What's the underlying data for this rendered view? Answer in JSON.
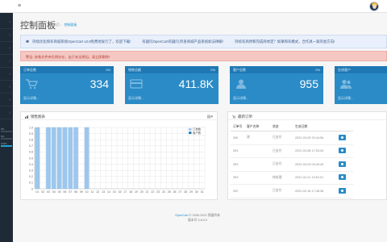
{
  "header": {
    "menu_icon": "hamburger-icon",
    "avatar_icon": "user-avatar-icon"
  },
  "sidebar": {
    "stats": [
      {
        "label": "0%",
        "percent": 0
      },
      {
        "label": "0%",
        "percent": 0
      },
      {
        "label": "100%",
        "percent": 100
      }
    ]
  },
  "page": {
    "title": "控制面板",
    "breadcrumb": [
      {
        "label": "首页"
      },
      {
        "label": "控制面板"
      }
    ]
  },
  "alerts": {
    "info_parts": [
      "持续优化和有商城系统OpenCart v3.8免费地发行了，欢迎下载!",
      "有疑问OpenCart有疑问,所查商城产品系统如法律解!",
      "持续有商用和完成商体定？如果和有模式，合作具一家的会方向!"
    ],
    "danger": "警告: 安装文件夹仍然存在，出于安全原因，请立即删除!"
  },
  "tiles": [
    {
      "title": "订单总数",
      "percent": "0%",
      "value": "334",
      "icon": "cart-icon",
      "footer": "显示详情..."
    },
    {
      "title": "销售总额",
      "percent": "0%",
      "value": "411.8K",
      "icon": "credit-card-icon",
      "footer": "显示详情..."
    },
    {
      "title": "客户总数",
      "percent": "0%",
      "value": "955",
      "icon": "user-icon",
      "footer": "显示详情..."
    },
    {
      "title": "在线客户",
      "percent": "",
      "value": "",
      "icon": "users-icon",
      "footer": "显示详情..."
    }
  ],
  "sales_panel": {
    "title": "销售图表",
    "calendar_icon": "calendar-icon",
    "legend": [
      {
        "name": "订单数",
        "color": "#9cc7ee"
      },
      {
        "name": "客户数",
        "color": "#1f78b4"
      }
    ]
  },
  "chart_data": {
    "type": "bar",
    "categories": [
      "01",
      "02",
      "03",
      "04",
      "05",
      "06",
      "07",
      "08",
      "09",
      "10",
      "11",
      "12",
      "13",
      "14",
      "15",
      "16",
      "17",
      "18",
      "19",
      "20",
      "21",
      "22",
      "23",
      "24",
      "25",
      "26",
      "27",
      "28",
      "29",
      "30",
      "31"
    ],
    "series": [
      {
        "name": "订单数",
        "values": [
          1,
          0,
          1,
          1,
          1,
          1,
          1,
          1,
          0,
          1,
          0,
          0,
          0,
          0,
          0,
          0,
          0,
          0,
          0,
          0,
          0,
          0,
          0,
          0,
          0,
          0,
          0,
          0,
          0,
          0,
          0
        ]
      }
    ],
    "ylim": [
      0,
      1
    ],
    "yticks": [
      "0",
      "0.1",
      "0.2",
      "0.3",
      "0.4",
      "0.5",
      "0.6",
      "0.7",
      "0.8",
      "0.9",
      "1.0"
    ],
    "grid": true,
    "legend_position": "top-right"
  },
  "orders_panel": {
    "title": "最新订单",
    "columns": [
      "订单号",
      "客户名称",
      "状态",
      "生成日期"
    ],
    "rows": [
      {
        "id": "395",
        "customer": "测",
        "status": "已支付",
        "date": "2022-03-09 20:44:56"
      },
      {
        "id": "394",
        "customer": "",
        "status": "已支付",
        "date": "2022-03-08 17:53:40"
      },
      {
        "id": "393",
        "customer": "",
        "status": "已支付",
        "date": "2022-03-03 09:40:49"
      },
      {
        "id": "393",
        "customer": "",
        "status": "待处理",
        "date": "2022-02-21 15:51:01"
      },
      {
        "id": "392",
        "customer": "",
        "status": "已支付",
        "date": "2022-02-18 17:48:36"
      }
    ]
  },
  "footer": {
    "brand": "OpenCart",
    "copyright": "© 2009-2022 保留所有",
    "version": "版本号 3.8.0.0"
  }
}
